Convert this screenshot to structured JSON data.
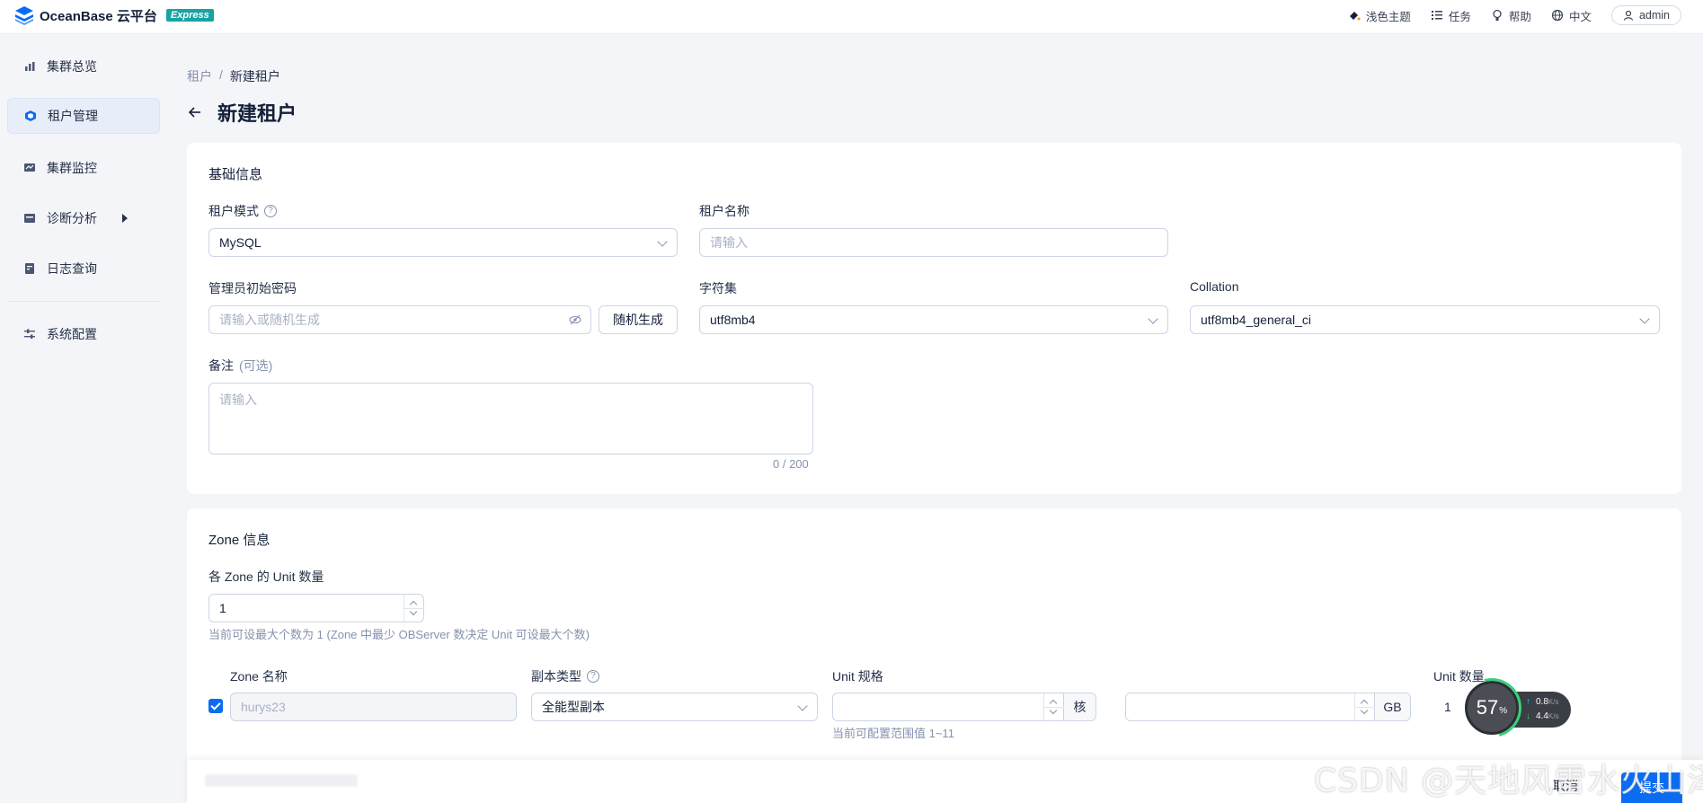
{
  "app": {
    "logo_text": "OceanBase 云平台",
    "badge": "Express",
    "accent": "#0b6cf3"
  },
  "topbar": {
    "theme": "浅色主题",
    "tasks": "任务",
    "help": "帮助",
    "language": "中文",
    "user": "admin"
  },
  "sidebar": {
    "items": [
      {
        "label": "集群总览",
        "icon": "bar-chart-icon"
      },
      {
        "label": "租户管理",
        "icon": "cube-icon",
        "active": true
      },
      {
        "label": "集群监控",
        "icon": "monitor-icon"
      },
      {
        "label": "诊断分析",
        "icon": "diagnose-icon",
        "has_submenu": true
      },
      {
        "label": "日志查询",
        "icon": "log-icon"
      },
      {
        "label": "系统配置",
        "icon": "settings-sliders-icon"
      }
    ]
  },
  "breadcrumb": {
    "parent": "租户",
    "separator": "/",
    "current": "新建租户"
  },
  "page": {
    "title": "新建租户"
  },
  "basic": {
    "title": "基础信息",
    "mode_label": "租户模式",
    "mode_value": "MySQL",
    "name_label": "租户名称",
    "name_placeholder": "请输入",
    "password_label": "管理员初始密码",
    "password_placeholder": "请输入或随机生成",
    "random_button": "随机生成",
    "charset_label": "字符集",
    "charset_value": "utf8mb4",
    "collation_label": "Collation",
    "collation_value": "utf8mb4_general_ci",
    "remark_label": "备注",
    "remark_optional": "(可选)",
    "remark_placeholder": "请输入",
    "remark_counter": "0 / 200"
  },
  "zone": {
    "title": "Zone 信息",
    "unit_count_label": "各 Zone 的 Unit 数量",
    "unit_count_value": "1",
    "unit_count_hint": "当前可设最大个数为 1 (Zone 中最少 OBServer 数决定 Unit 可设最大个数)",
    "col_zone_name": "Zone 名称",
    "col_replica_type": "副本类型",
    "col_unit_spec": "Unit 规格",
    "col_unit_count": "Unit 数量",
    "rows": [
      {
        "checked": true,
        "zone_name": "hurys23",
        "replica_type": "全能型副本",
        "cpu_value": "",
        "cpu_unit": "核",
        "memory_value": "",
        "memory_unit": "GB",
        "spec_hint": "当前可配置范围值 1~11",
        "unit_count": "1"
      }
    ]
  },
  "footer": {
    "cancel": "取消",
    "submit": "提交"
  },
  "network_widget": {
    "percent": "57",
    "percent_unit": "%",
    "upload": "0.8",
    "download": "4.4",
    "rate_unit": "K/s"
  },
  "watermark": "CSDN @天地风雷水火山泽"
}
